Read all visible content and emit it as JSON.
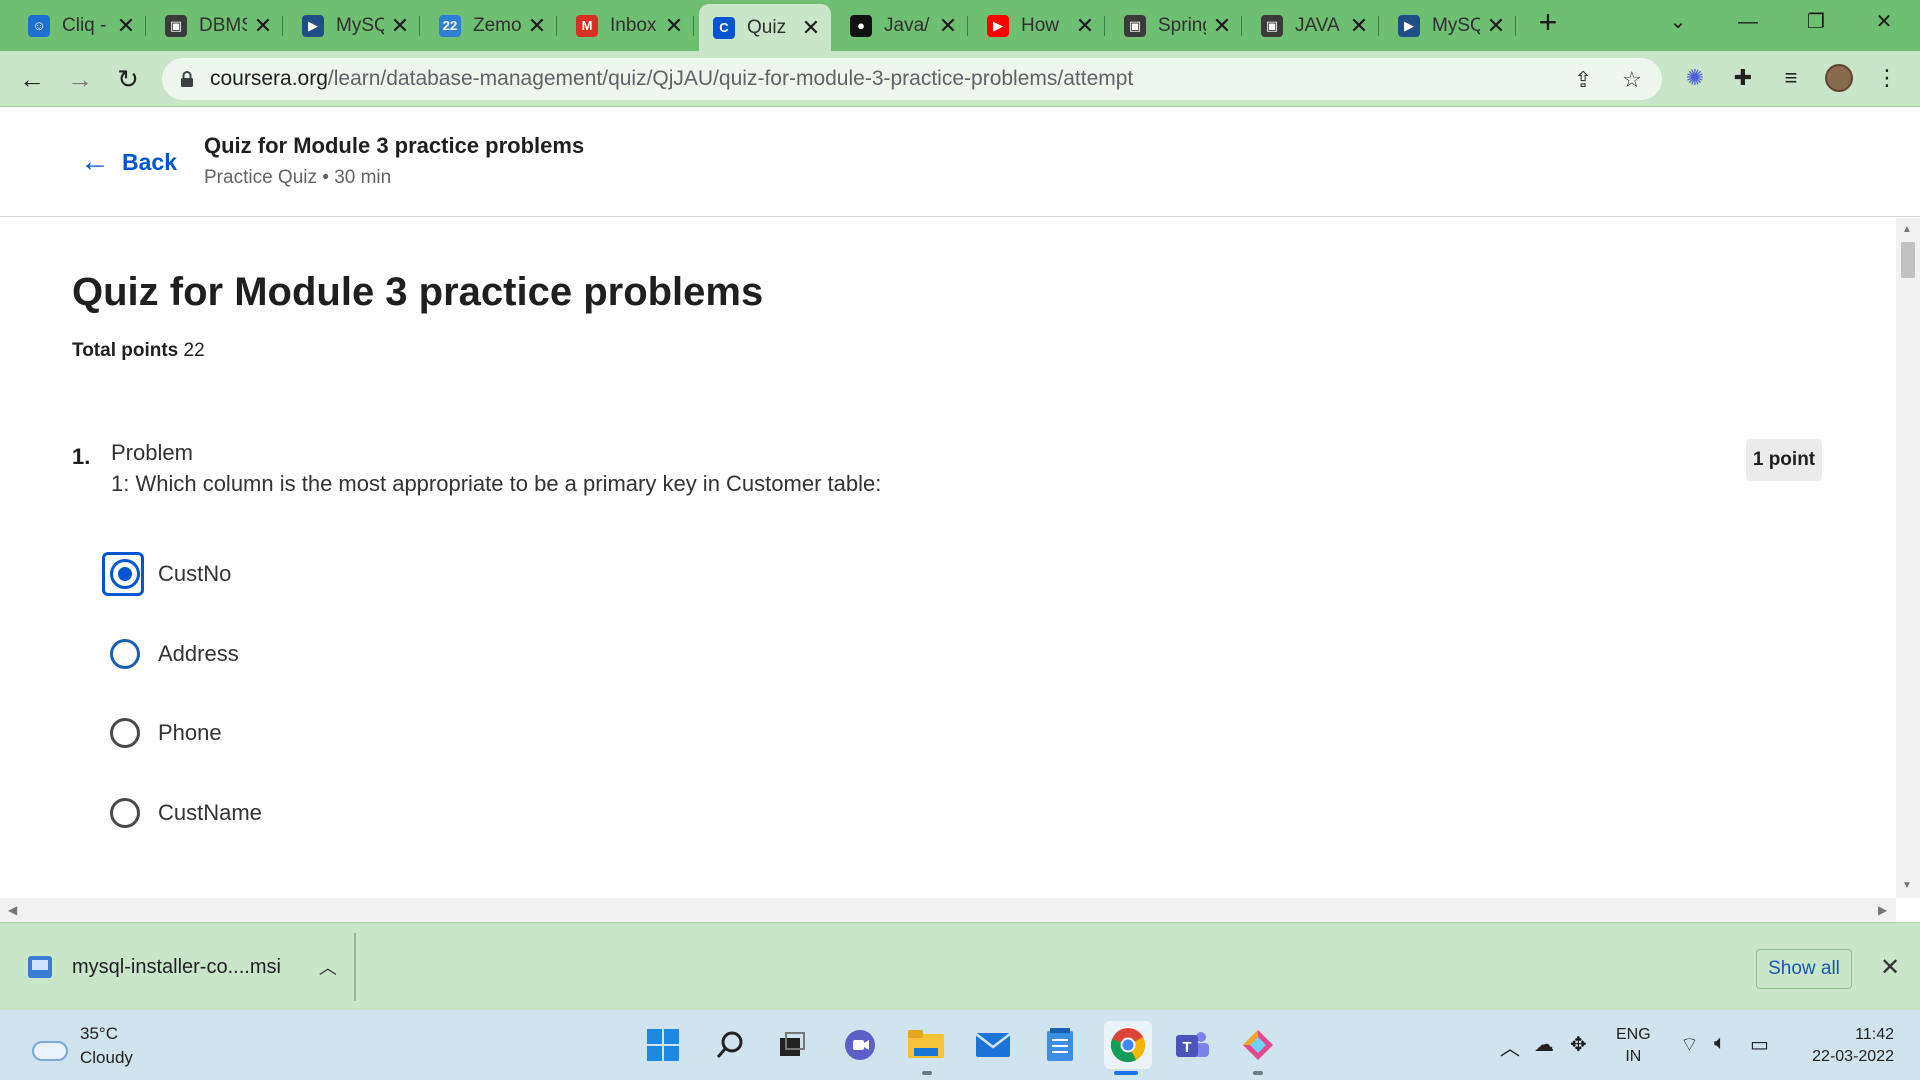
{
  "browser": {
    "tabs": [
      {
        "title": "Cliq -",
        "icon": "cliq-icon",
        "color": "#1f6fd1",
        "glyph": "☺"
      },
      {
        "title": "DBMS",
        "icon": "profile-icon",
        "color": "#3a3a3a",
        "glyph": "▣"
      },
      {
        "title": "MySQL",
        "icon": "mysql-icon",
        "color": "#1f4e86",
        "glyph": "▶"
      },
      {
        "title": "Zemos",
        "icon": "calendar-icon",
        "color": "#2f7fd8",
        "glyph": "22"
      },
      {
        "title": "Inbox",
        "icon": "gmail-icon",
        "color": "#d93025",
        "glyph": "M"
      },
      {
        "title": "Quiz",
        "icon": "coursera-icon",
        "color": "#0056d2",
        "glyph": "C"
      },
      {
        "title": "Java/",
        "icon": "github-icon",
        "color": "#111111",
        "glyph": "●"
      },
      {
        "title": "How",
        "icon": "youtube-icon",
        "color": "#ff0000",
        "glyph": "▶"
      },
      {
        "title": "Spring",
        "icon": "profile-icon",
        "color": "#3a3a3a",
        "glyph": "▣"
      },
      {
        "title": "JAVA",
        "icon": "profile-icon",
        "color": "#3a3a3a",
        "glyph": "▣"
      },
      {
        "title": "MySQL",
        "icon": "mysql-icon",
        "color": "#1f4e86",
        "glyph": "▶"
      }
    ],
    "active_tab_index": 5,
    "close_glyph": "✕",
    "new_tab_glyph": "+",
    "url_host": "coursera.org",
    "url_path": "/learn/database-management/quiz/QjJAU/quiz-for-module-3-practice-problems/attempt"
  },
  "header": {
    "back_label": "Back",
    "title": "Quiz for Module 3 practice problems",
    "subtitle": "Practice Quiz • 30 min"
  },
  "quiz": {
    "title": "Quiz for Module 3 practice problems",
    "total_points_label": "Total points",
    "total_points_value": "22",
    "question": {
      "number": "1.",
      "text_line1": "Problem",
      "text_line2": "1: Which column is the most appropriate to be a primary key in Customer table:",
      "points": "1 point",
      "options": [
        "CustNo",
        "Address",
        "Phone",
        "CustName"
      ],
      "selected_index": 0
    }
  },
  "downloads": {
    "file_name": "mysql-installer-co....msi",
    "show_all": "Show all"
  },
  "taskbar": {
    "weather_temp": "35°C",
    "weather_desc": "Cloudy",
    "lang_top": "ENG",
    "lang_bottom": "IN",
    "time": "11:42",
    "date": "22-03-2022"
  }
}
